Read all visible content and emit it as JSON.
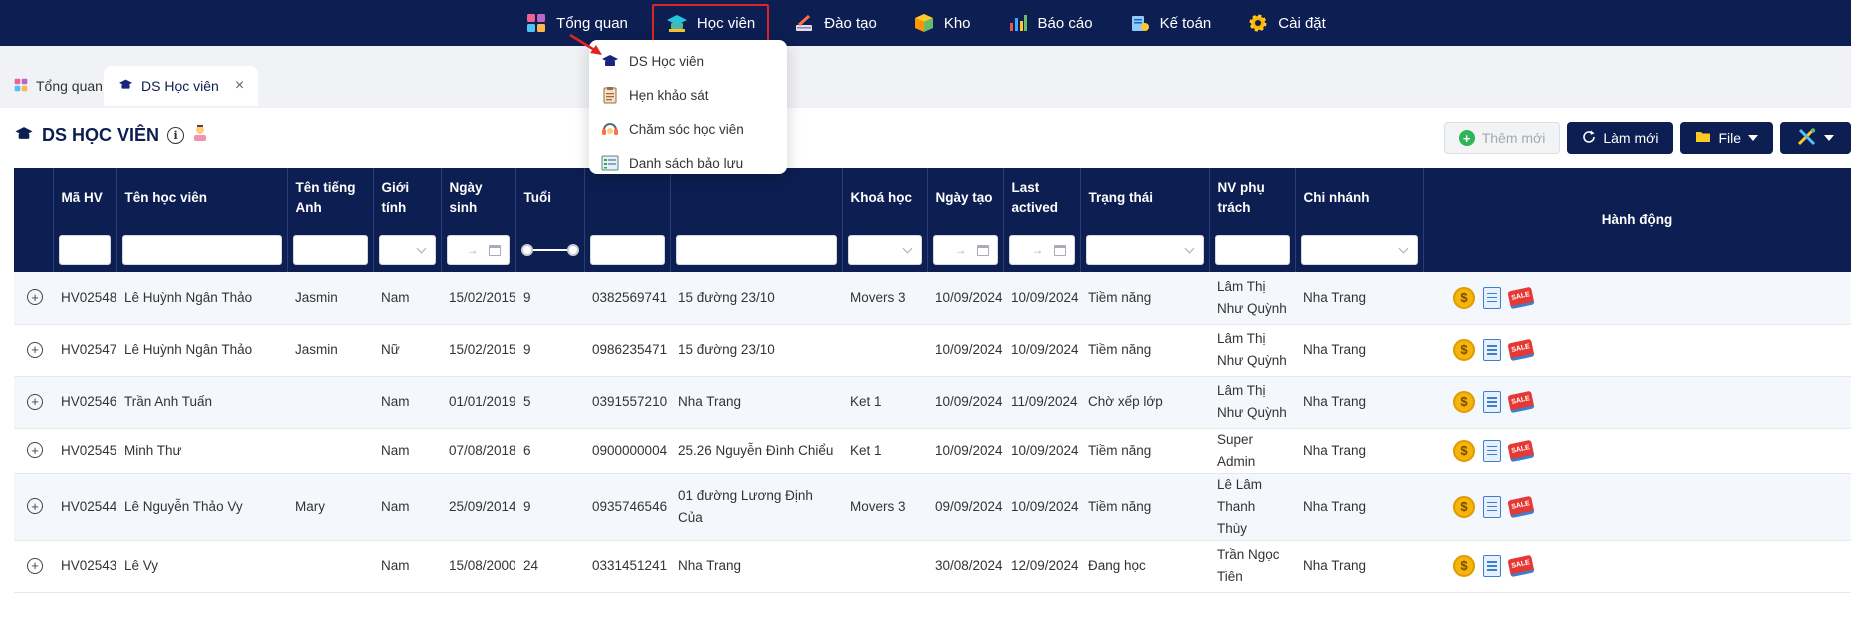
{
  "nav": [
    {
      "label": "Tổng quan",
      "icon": "dashboard-icon"
    },
    {
      "label": "Học viên",
      "icon": "graduation-cap-icon",
      "active": true
    },
    {
      "label": "Đào tạo",
      "icon": "training-icon"
    },
    {
      "label": "Kho",
      "icon": "warehouse-box-icon"
    },
    {
      "label": "Báo cáo",
      "icon": "bar-chart-icon"
    },
    {
      "label": "Kế toán",
      "icon": "accounting-icon"
    },
    {
      "label": "Cài đặt",
      "icon": "gear-icon"
    }
  ],
  "dropdown": [
    {
      "label": "DS Học viên",
      "icon": "graduation-cap-icon"
    },
    {
      "label": "Hẹn khảo sát",
      "icon": "clipboard-icon"
    },
    {
      "label": "Chăm sóc học viên",
      "icon": "headset-icon"
    },
    {
      "label": "Danh sách bảo lưu",
      "icon": "list-table-icon"
    }
  ],
  "tabs": [
    {
      "label": "Tổng quan"
    },
    {
      "label": "DS Học viên",
      "close": "×"
    }
  ],
  "page": {
    "title": "DS HỌC VIÊN",
    "info": "i"
  },
  "toolbar": {
    "add_label": "Thêm mới",
    "refresh_label": "Làm mới",
    "file_label": "File"
  },
  "table": {
    "columns": [
      "Mã HV",
      "Tên học viên",
      "Tên tiếng Anh",
      "Giới tính",
      "Ngày sinh",
      "Tuổi",
      "",
      "",
      "Khoá học",
      "Ngày tạo",
      "Last actived",
      "Trạng thái",
      "NV phụ trách",
      "Chi nhánh",
      "Hành động"
    ],
    "date_arrow": "→",
    "rows": [
      [
        "HV02548",
        "Lê Huỳnh Ngân Thảo",
        "Jasmin",
        "Nam",
        "15/02/2015",
        "9",
        "0382569741",
        "15 đường 23/10",
        "Movers 3",
        "10/09/2024",
        "10/09/2024",
        "Tiềm năng",
        "Lâm Thị Như Quỳnh",
        "Nha Trang"
      ],
      [
        "HV02547",
        "Lê Huỳnh Ngân Thảo",
        "Jasmin",
        "Nữ",
        "15/02/2015",
        "9",
        "0986235471",
        "15 đường 23/10",
        "",
        "10/09/2024",
        "10/09/2024",
        "Tiềm năng",
        "Lâm Thị Như Quỳnh",
        "Nha Trang"
      ],
      [
        "HV02546",
        "Trần Anh Tuấn",
        "",
        "Nam",
        "01/01/2019",
        "5",
        "0391557210",
        "Nha Trang",
        "Ket 1",
        "10/09/2024",
        "11/09/2024",
        "Chờ xếp lớp",
        "Lâm Thị Như Quỳnh",
        "Nha Trang"
      ],
      [
        "HV02545",
        "Minh Thư",
        "",
        "Nam",
        "07/08/2018",
        "6",
        "0900000004",
        "25.26 Nguyễn Đình Chiểu",
        "Ket 1",
        "10/09/2024",
        "10/09/2024",
        "Tiềm năng",
        "Super Admin",
        "Nha Trang"
      ],
      [
        "HV02544",
        "Lê Nguyễn Thảo Vy",
        "Mary",
        "Nam",
        "25/09/2014",
        "9",
        "0935746546",
        "01 đường Lương Định Của",
        "Movers 3",
        "09/09/2024",
        "10/09/2024",
        "Tiềm năng",
        "Lê Lâm Thanh Thùy",
        "Nha Trang"
      ],
      [
        "HV02543",
        "Lê Vy",
        "",
        "Nam",
        "15/08/2000",
        "24",
        "0331451241",
        "Nha Trang",
        "",
        "30/08/2024",
        "12/09/2024",
        "Đang học",
        "Trần Ngọc Tiên",
        "Nha Trang"
      ]
    ],
    "actions": {
      "coin": "$",
      "sale": "SALE"
    },
    "expand": "+"
  },
  "colors": {
    "nav_bg": "#0c1e52",
    "highlight": "#e02424",
    "accent_green": "#2fb457"
  }
}
